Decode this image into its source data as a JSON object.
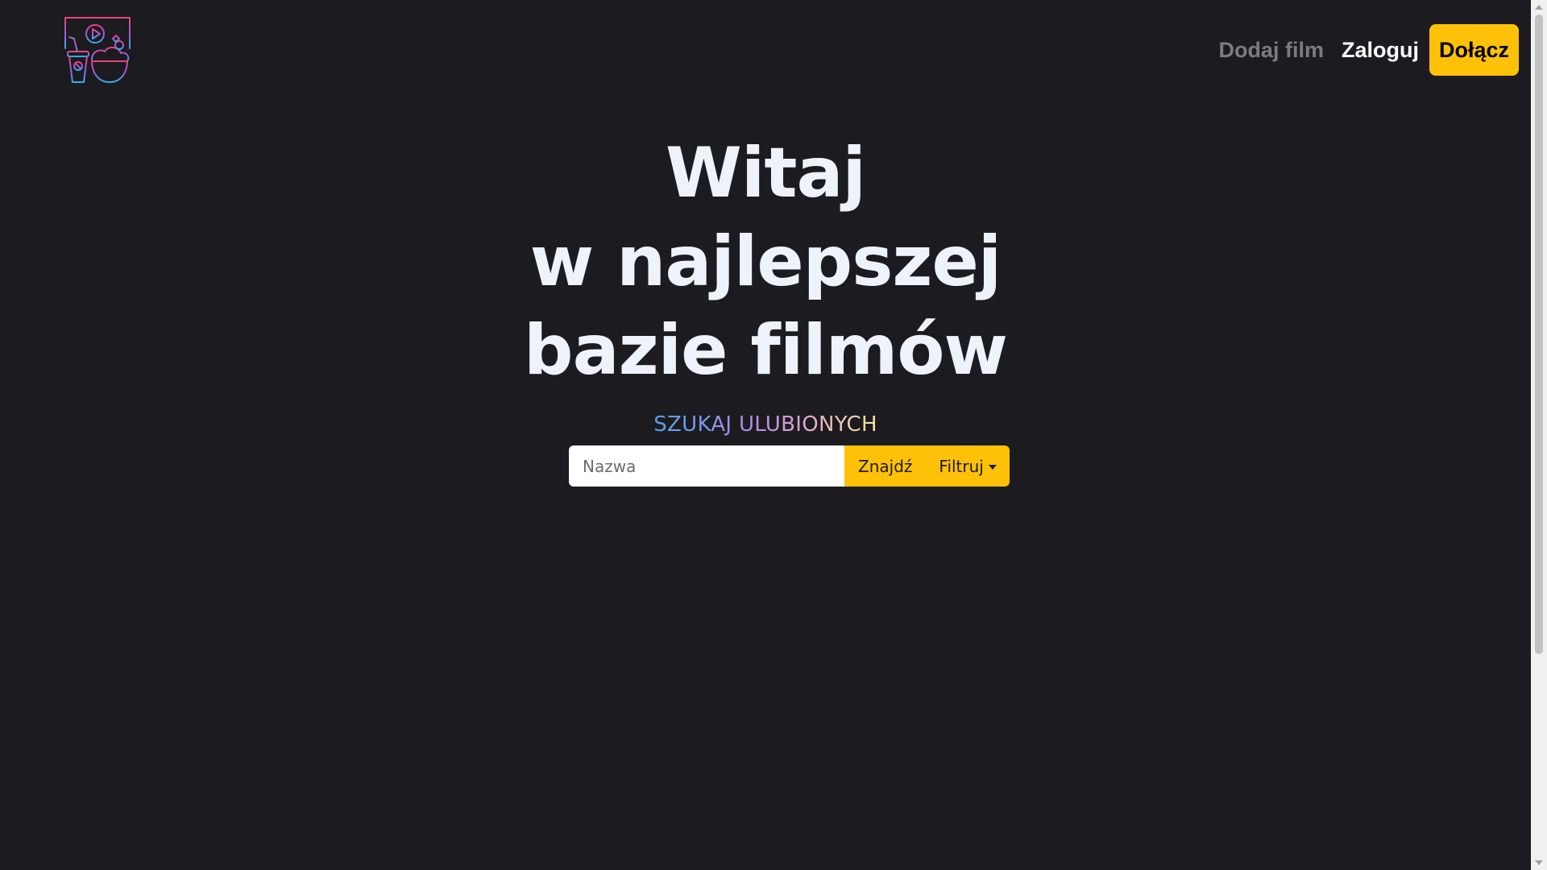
{
  "brand": {
    "logo_icon": "cinema-popcorn-logo-icon",
    "gradient_colors": [
      "#e6447b",
      "#8d5be0",
      "#3aa7e0"
    ]
  },
  "nav": {
    "add_film": "Dodaj film",
    "login": "Zaloguj",
    "join": "Dołącz"
  },
  "hero": {
    "title_lines": [
      "Witaj",
      "w najlepszej",
      "bazie filmów"
    ],
    "subtitle": "SZUKAJ ULUBIONYCH"
  },
  "search": {
    "placeholder": "Nazwa",
    "value": "",
    "find_label": "Znajdź",
    "filter_label": "Filtruj"
  },
  "colors": {
    "background": "#1c1b20",
    "accent": "#ffc107",
    "title": "#eef3fb",
    "muted_link": "#7b7b80"
  }
}
